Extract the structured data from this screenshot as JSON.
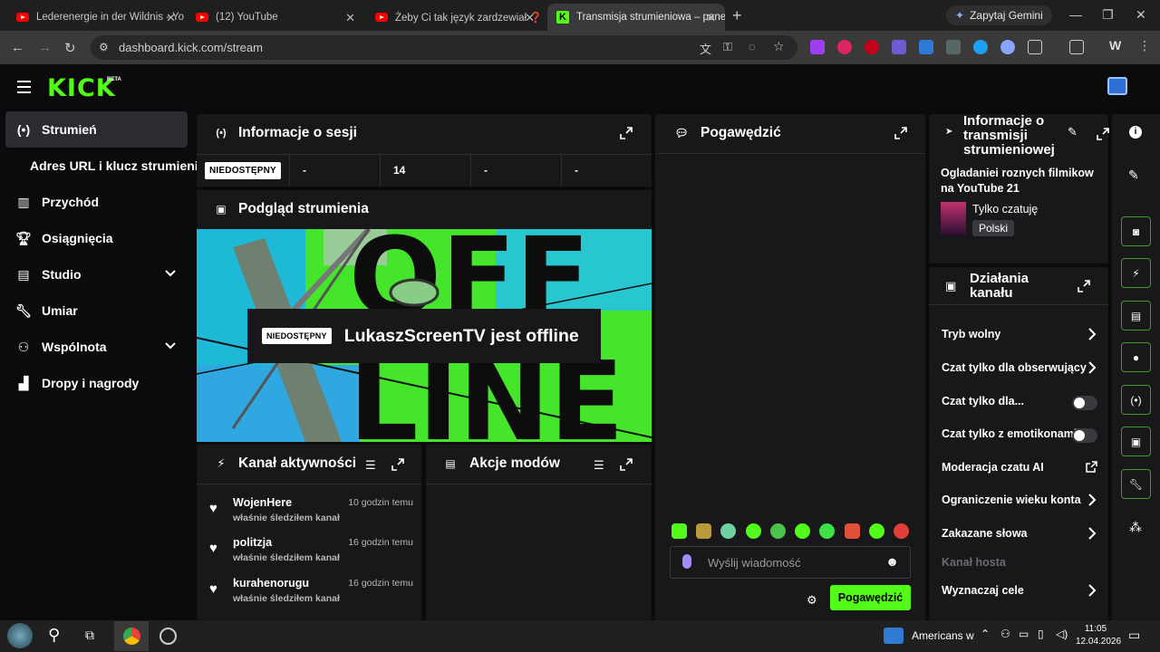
{
  "browser": {
    "tabs": [
      {
        "title": "Lederenergie in der Wildnis - Yo"
      },
      {
        "title": "(12) YouTube"
      },
      {
        "title": "Żeby Ci tak język zardzewiał ❓"
      },
      {
        "title": "Transmisja strumieniowa – pane"
      }
    ],
    "gemini_label": "Zapytaj Gemini",
    "url": "dashboard.kick.com/stream"
  },
  "app": {
    "logo": "KICK",
    "beta": "BETA",
    "sidebar": [
      {
        "label": "Strumień",
        "icon": "broadcast-icon"
      },
      {
        "label": "Adres URL i klucz strumienia",
        "icon": ""
      },
      {
        "label": "Przychód",
        "icon": "chart-icon"
      },
      {
        "label": "Osiągnięcia",
        "icon": "trophy-icon"
      },
      {
        "label": "Studio",
        "icon": "folder-icon"
      },
      {
        "label": "Umiar",
        "icon": "wrench-icon"
      },
      {
        "label": "Wspólnota",
        "icon": "community-icon"
      },
      {
        "label": "Dropy i nagrody",
        "icon": "gift-icon"
      }
    ],
    "session": {
      "title": "Informacje o sesji",
      "status": "NIEDOSTĘPNY",
      "stats": [
        "-",
        "14",
        "-",
        "-"
      ]
    },
    "preview": {
      "title": "Podgląd strumienia",
      "status": "NIEDOSTĘPNY",
      "message": "LukaszScreenTV jest offline"
    },
    "activity": {
      "title": "Kanał aktywności",
      "items": [
        {
          "name": "WojenHere",
          "sub": "właśnie śledziłem kanał",
          "time": "10 godzin temu"
        },
        {
          "name": "politzja",
          "sub": "właśnie śledziłem kanał",
          "time": "16 godzin temu"
        },
        {
          "name": "kurahenorugu",
          "sub": "właśnie śledziłem kanał",
          "time": "16 godzin temu"
        }
      ]
    },
    "modactions": {
      "title": "Akcje modów"
    },
    "chat": {
      "title": "Pogawędzić",
      "placeholder": "Wyślij wiadomość",
      "send": "Pogawędzić"
    },
    "streaminfo": {
      "title_l1": "Informacje o",
      "title_l2": "transmisji",
      "title_l3": "strumieniowej",
      "stream_title": "Ogladaniei roznych filmikow na YouTube 21",
      "category": "Tylko czatuję",
      "language": "Polski"
    },
    "channel_actions": {
      "title_l1": "Działania",
      "title_l2": "kanału",
      "rows": [
        {
          "label": "Tryb wolny",
          "kind": "arrow"
        },
        {
          "label": "Czat tylko dla obserwujący",
          "kind": "arrow"
        },
        {
          "label": "Czat tylko dla...",
          "kind": "toggle"
        },
        {
          "label": "Czat tylko z emotikonami",
          "kind": "toggle"
        },
        {
          "label": "Moderacja czatu AI",
          "kind": "external"
        },
        {
          "label": "Ograniczenie wieku konta",
          "kind": "arrow"
        },
        {
          "label": "Zakazane słowa",
          "kind": "arrow"
        },
        {
          "label": "Kanał hosta",
          "kind": "disabled"
        },
        {
          "label": "Wyznaczaj cele",
          "kind": "arrow"
        }
      ]
    }
  },
  "taskbar": {
    "news": "Americans w",
    "time": "11:05",
    "date": "12.04.2026"
  },
  "colors": {
    "accent": "#53fc18",
    "panel": "#18181b",
    "background": "#0b0b0d"
  }
}
